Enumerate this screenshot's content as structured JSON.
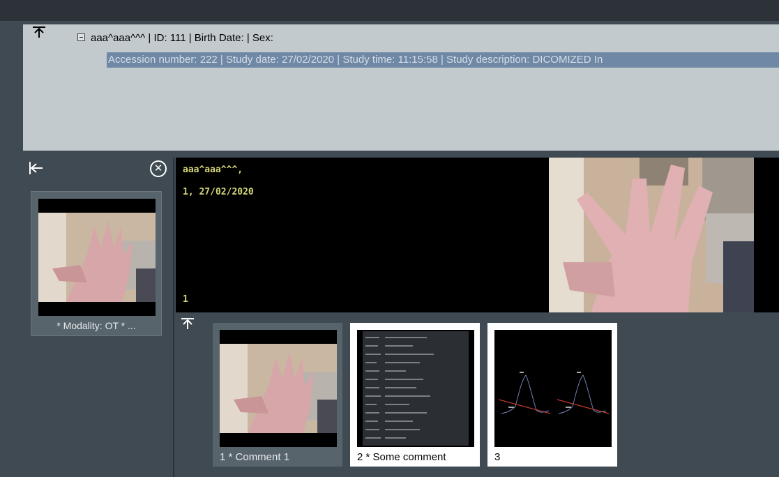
{
  "patient": {
    "name_line": "aaa^aaa^^^ | ID: 111 | Birth Date:  | Sex:",
    "study_line": "Accession number: 222 | Study date: 27/02/2020 | Study time: 11:15:58 | Study description: DICOMIZED In"
  },
  "series": {
    "thumb_label": "* Modality: OT * ..."
  },
  "viewer": {
    "overlay_name": "aaa^aaa^^^,",
    "overlay_id_date": "1, 27/02/2020",
    "overlay_index": "1"
  },
  "instances": [
    {
      "label": "1 * Comment 1"
    },
    {
      "label": "2 * Some comment"
    },
    {
      "label": "3"
    }
  ],
  "icons": {
    "collapse_up": "arrow-up-to-bar-icon",
    "collapse_left": "arrow-left-to-bar-icon",
    "close": "close-circle-icon",
    "tree_toggle": "tree-minus-icon"
  },
  "colors": {
    "patient_panel_bg": "#c2cacd",
    "study_row_highlight": "#6e88a6",
    "overlay_text": "#d6d67a"
  }
}
